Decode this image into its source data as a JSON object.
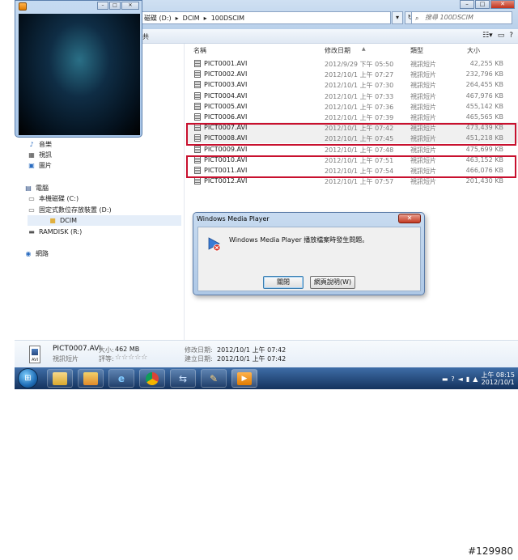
{
  "address_bar": {
    "path": [
      "磁碟 (D:)",
      "DCIM",
      "100DSCIM"
    ],
    "separator": "▸",
    "search_placeholder": "搜尋 100DSCIM"
  },
  "toolbar": {
    "left_label": "共"
  },
  "nav_pane": {
    "items": [
      {
        "label": "音樂",
        "icon": "music-note-icon"
      },
      {
        "label": "視訊",
        "icon": "video-library-icon"
      },
      {
        "label": "圖片",
        "icon": "pictures-library-icon"
      },
      {
        "label": "電腦",
        "icon": "computer-icon"
      },
      {
        "label": "本機磁碟 (C:)",
        "icon": "hard-disk-icon"
      },
      {
        "label": "固定式數位存放裝置 (D:)",
        "icon": "removable-drive-icon"
      },
      {
        "label": "DCIM",
        "icon": "folder-icon"
      },
      {
        "label": "RAMDISK (R:)",
        "icon": "ram-disk-icon"
      },
      {
        "label": "網路",
        "icon": "network-icon"
      }
    ]
  },
  "file_list": {
    "columns": {
      "name": "名稱",
      "date": "修改日期",
      "type": "類型",
      "size": "大小"
    },
    "rows": [
      {
        "name": "PICT0001.AVI",
        "date": "2012/9/29 下午 05:50",
        "type": "視訊短片",
        "size": "42,255 KB"
      },
      {
        "name": "PICT0002.AVI",
        "date": "2012/10/1 上午 07:27",
        "type": "視訊短片",
        "size": "232,796 KB"
      },
      {
        "name": "PICT0003.AVI",
        "date": "2012/10/1 上午 07:30",
        "type": "視訊短片",
        "size": "264,455 KB"
      },
      {
        "name": "PICT0004.AVI",
        "date": "2012/10/1 上午 07:33",
        "type": "視訊短片",
        "size": "467,976 KB"
      },
      {
        "name": "PICT0005.AVI",
        "date": "2012/10/1 上午 07:36",
        "type": "視訊短片",
        "size": "455,142 KB"
      },
      {
        "name": "PICT0006.AVI",
        "date": "2012/10/1 上午 07:39",
        "type": "視訊短片",
        "size": "465,565 KB"
      },
      {
        "name": "PICT0007.AVI",
        "date": "2012/10/1 上午 07:42",
        "type": "視訊短片",
        "size": "473,439 KB"
      },
      {
        "name": "PICT0008.AVI",
        "date": "2012/10/1 上午 07:45",
        "type": "視訊短片",
        "size": "451,218 KB"
      },
      {
        "name": "PICT0009.AVI",
        "date": "2012/10/1 上午 07:48",
        "type": "視訊短片",
        "size": "475,699 KB"
      },
      {
        "name": "PICT0010.AVI",
        "date": "2012/10/1 上午 07:51",
        "type": "視訊短片",
        "size": "463,152 KB"
      },
      {
        "name": "PICT0011.AVI",
        "date": "2012/10/1 上午 07:54",
        "type": "視訊短片",
        "size": "466,076 KB"
      },
      {
        "name": "PICT0012.AVI",
        "date": "2012/10/1 上午 07:57",
        "type": "視訊短片",
        "size": "201,430 KB"
      }
    ]
  },
  "details_pane": {
    "file_name": "PICT0007.AVI",
    "size_label": "大小:",
    "size_value": "462 MB",
    "type": "視訊短片",
    "rating_label": "評等:",
    "rating_stars": "☆☆☆☆☆",
    "modified_label": "修改日期:",
    "modified_value": "2012/10/1 上午 07:42",
    "created_label": "建立日期:",
    "created_value": "2012/10/1 上午 07:42",
    "icon_caption": "AVI"
  },
  "dialog": {
    "title": "Windows Media Player",
    "close_glyph": "✕",
    "message": "Windows Media Player 播放檔案時發生問題。",
    "close_button": "關閉",
    "help_button": "網頁說明(W)"
  },
  "taskbar": {
    "clock_time": "上午 08:15",
    "clock_date": "2012/10/1",
    "buttons": [
      "windows-explorer-icon",
      "paint-icon",
      "internet-explorer-icon",
      "chrome-icon",
      "network-tool-icon",
      "paint-brush-icon",
      "media-player-icon"
    ]
  },
  "watermark": "#129980"
}
